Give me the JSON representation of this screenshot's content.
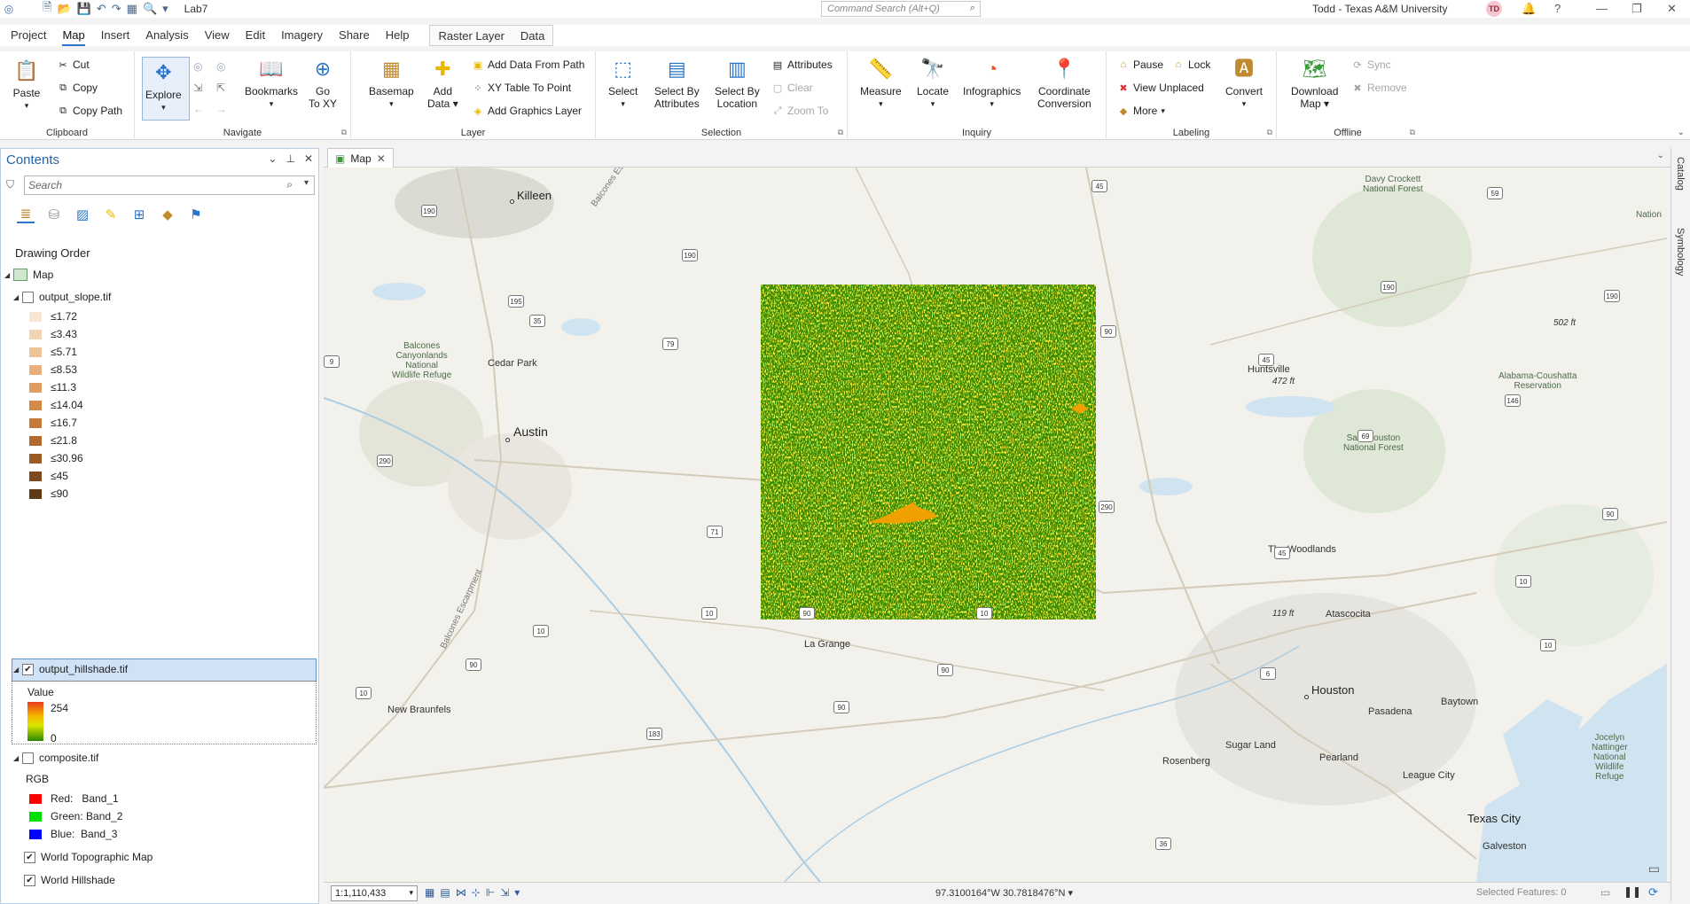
{
  "titlebar": {
    "project_name": "Lab7",
    "command_search_placeholder": "Command Search (Alt+Q)",
    "user": "Todd - Texas A&M University",
    "user_initials": "TD"
  },
  "tabs": [
    "Project",
    "Map",
    "Insert",
    "Analysis",
    "View",
    "Edit",
    "Imagery",
    "Share",
    "Help"
  ],
  "context_tabs": [
    "Raster Layer",
    "Data"
  ],
  "ribbon": {
    "clipboard": {
      "label": "Clipboard",
      "paste": "Paste",
      "cut": "Cut",
      "copy": "Copy",
      "copy_path": "Copy Path"
    },
    "navigate": {
      "label": "Navigate",
      "explore": "Explore",
      "bookmarks": "Bookmarks",
      "go_to_xy_1": "Go",
      "go_to_xy_2": "To XY"
    },
    "layer": {
      "label": "Layer",
      "basemap": "Basemap",
      "add_data_1": "Add",
      "add_data_2": "Data",
      "add_data_from_path": "Add Data From Path",
      "xy_table_to_point": "XY Table To Point",
      "add_graphics_layer": "Add Graphics Layer"
    },
    "selection": {
      "label": "Selection",
      "select": "Select",
      "select_by_attr_1": "Select By",
      "select_by_attr_2": "Attributes",
      "select_by_loc_1": "Select By",
      "select_by_loc_2": "Location",
      "attributes": "Attributes",
      "clear": "Clear",
      "zoom_to": "Zoom To"
    },
    "inquiry": {
      "label": "Inquiry",
      "measure": "Measure",
      "locate": "Locate",
      "infographics": "Infographics",
      "coord_conv_1": "Coordinate",
      "coord_conv_2": "Conversion"
    },
    "labeling": {
      "label": "Labeling",
      "pause": "Pause",
      "lock": "Lock",
      "view_unplaced": "View Unplaced",
      "more": "More",
      "convert": "Convert"
    },
    "offline": {
      "label": "Offline",
      "download_map_1": "Download",
      "download_map_2": "Map",
      "sync": "Sync",
      "remove": "Remove"
    }
  },
  "contents": {
    "title": "Contents",
    "search_placeholder": "Search",
    "drawing_order": "Drawing Order",
    "map_label": "Map",
    "slope_layer": {
      "name": "output_slope.tif",
      "classes": [
        {
          "label": "≤1.72",
          "color": "#f8e6d4"
        },
        {
          "label": "≤3.43",
          "color": "#f3d4b5"
        },
        {
          "label": "≤5.71",
          "color": "#eec397"
        },
        {
          "label": "≤8.53",
          "color": "#e8b07a"
        },
        {
          "label": "≤11.3",
          "color": "#e09d5f"
        },
        {
          "label": "≤14.04",
          "color": "#d58a47"
        },
        {
          "label": "≤16.7",
          "color": "#c67a39"
        },
        {
          "label": "≤21.8",
          "color": "#b46a2e"
        },
        {
          "label": "≤30.96",
          "color": "#9c5a24"
        },
        {
          "label": "≤45",
          "color": "#7e4a1d"
        },
        {
          "label": "≤90",
          "color": "#5e3a16"
        }
      ]
    },
    "hillshade_layer": {
      "name": "output_hillshade.tif",
      "value_label": "Value",
      "high": "254",
      "low": "0"
    },
    "composite_layer": {
      "name": "composite.tif",
      "rgb_label": "RGB",
      "bands": [
        {
          "label": "Red:   Band_1",
          "color": "#ff0000"
        },
        {
          "label": "Green: Band_2",
          "color": "#00e000"
        },
        {
          "label": "Blue:  Band_3",
          "color": "#0000ff"
        }
      ]
    },
    "basemaps": [
      "World Topographic Map",
      "World Hillshade"
    ]
  },
  "map_tab": "Map",
  "map_labels": {
    "killeen": "Killeen",
    "cedar_park": "Cedar Park",
    "austin": "Austin",
    "balcones_refuge": "Balcones\nCanyonlands\nNational\nWildlife Refuge",
    "la_grange": "La Grange",
    "new_braunfels": "New Braunfels",
    "huntsville": "Huntsville",
    "the_woodlands": "The Woodlands",
    "atascocita": "Atascocita",
    "houston": "Houston",
    "pasadena": "Pasadena",
    "baytown": "Baytown",
    "sugar_land": "Sugar Land",
    "pearland": "Pearland",
    "rosenberg": "Rosenberg",
    "league_city": "League City",
    "texas_city": "Texas City",
    "galveston": "Galveston",
    "davy_crockett": "Davy Crockett\nNational Forest",
    "sam_houston": "Sam Houston\nNational Forest",
    "alabama_coushatta": "Alabama-Coushatta\nReservation",
    "jocelyn": "Jocelyn\nNattinger\nNational\nWildlife\nRefuge",
    "elev_472": "472 ft",
    "elev_502": "502 ft",
    "elev_119": "119 ft",
    "escarpment_1": "Balcones Escarpment",
    "escarpment_2": "Balcones Escarpment",
    "nation": "Nation"
  },
  "highway_shields": [
    "190",
    "190",
    "195",
    "35",
    "79",
    "45",
    "59",
    "190",
    "190",
    "90",
    "45",
    "146",
    "69",
    "290",
    "290",
    "71",
    "45",
    "90",
    "10",
    "10",
    "90",
    "10",
    "10",
    "90",
    "10",
    "90",
    "183",
    "6",
    "36",
    "90",
    "10",
    "9"
  ],
  "side_panel": {
    "catalog": "Catalog",
    "symbology": "Symbology"
  },
  "statusbar": {
    "scale": "1:1,110,433",
    "coordinates": "97.3100164°W 30.7818476°N",
    "selected_features": "Selected Features: 0"
  }
}
